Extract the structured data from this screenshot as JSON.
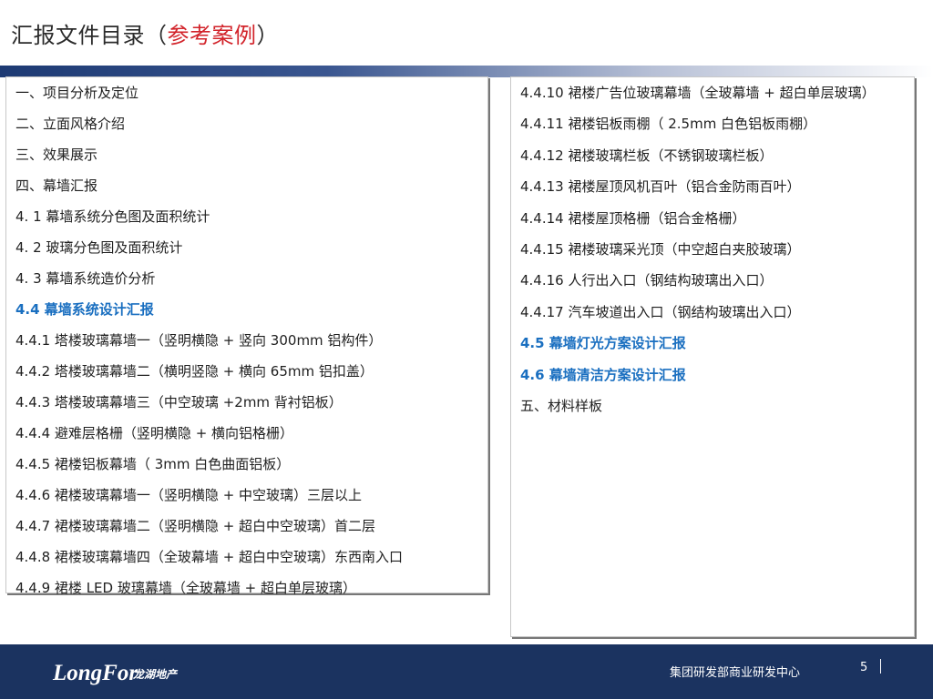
{
  "header": {
    "title_prefix": "汇报文件目录（",
    "title_accent": "参考案例",
    "title_suffix": "）"
  },
  "colors": {
    "accent_red": "#d2232a",
    "highlight_blue": "#1a6fc0",
    "footer_navy": "#1b3360"
  },
  "toc_left": [
    {
      "text": "一、项目分析及定位",
      "highlight": false
    },
    {
      "text": "二、立面风格介绍",
      "highlight": false
    },
    {
      "text": "三、效果展示",
      "highlight": false
    },
    {
      "text": "四、幕墙汇报",
      "highlight": false
    },
    {
      "text": "4. 1 幕墙系统分色图及面积统计",
      "highlight": false
    },
    {
      "text": "4. 2 玻璃分色图及面积统计",
      "highlight": false
    },
    {
      "text": "4. 3 幕墙系统造价分析",
      "highlight": false
    },
    {
      "text": "4.4 幕墙系统设计汇报",
      "highlight": true
    },
    {
      "text": "4.4.1 塔楼玻璃幕墙一（竖明横隐 + 竖向 300mm 铝构件）",
      "highlight": false
    },
    {
      "text": "4.4.2 塔楼玻璃幕墙二（横明竖隐 + 横向 65mm 铝扣盖）",
      "highlight": false
    },
    {
      "text": "4.4.3 塔楼玻璃幕墙三（中空玻璃 +2mm 背衬铝板）",
      "highlight": false
    },
    {
      "text": "4.4.4 避难层格栅（竖明横隐 + 横向铝格栅）",
      "highlight": false
    },
    {
      "text": "4.4.5 裙楼铝板幕墙（ 3mm 白色曲面铝板）",
      "highlight": false
    },
    {
      "text": "4.4.6 裙楼玻璃幕墙一（竖明横隐 + 中空玻璃）三层以上",
      "highlight": false
    },
    {
      "text": "4.4.7 裙楼玻璃幕墙二（竖明横隐 + 超白中空玻璃）首二层",
      "highlight": false
    },
    {
      "text": "4.4.8 裙楼玻璃幕墙四（全玻幕墙 + 超白中空玻璃）东西南入口",
      "highlight": false
    },
    {
      "text": "4.4.9 裙楼 LED 玻璃幕墙（全玻幕墙 + 超白单层玻璃）",
      "highlight": false
    }
  ],
  "toc_right": [
    {
      "text": "4.4.10 裙楼广告位玻璃幕墙（全玻幕墙 + 超白单层玻璃）",
      "highlight": false,
      "wrap": true
    },
    {
      "text": "4.4.11 裙楼铝板雨棚（ 2.5mm 白色铝板雨棚）",
      "highlight": false
    },
    {
      "text": "4.4.12 裙楼玻璃栏板（不锈钢玻璃栏板）",
      "highlight": false
    },
    {
      "text": "4.4.13 裙楼屋顶风机百叶（铝合金防雨百叶）",
      "highlight": false
    },
    {
      "text": "4.4.14 裙楼屋顶格栅（铝合金格栅）",
      "highlight": false
    },
    {
      "text": "4.4.15 裙楼玻璃采光顶（中空超白夹胶玻璃）",
      "highlight": false
    },
    {
      "text": "4.4.16 人行出入口（钢结构玻璃出入口）",
      "highlight": false
    },
    {
      "text": "4.4.17 汽车坡道出入口（钢结构玻璃出入口）",
      "highlight": false
    },
    {
      "text": "4.5 幕墙灯光方案设计汇报",
      "highlight": true
    },
    {
      "text": "4.6 幕墙清洁方案设计汇报",
      "highlight": true
    },
    {
      "text": "五、材料样板",
      "highlight": false
    }
  ],
  "footer": {
    "logo_text": "LongFor",
    "logo_cn": "龙湖地产",
    "dept": "集团研发部商业研发中心",
    "page_number": "5"
  }
}
